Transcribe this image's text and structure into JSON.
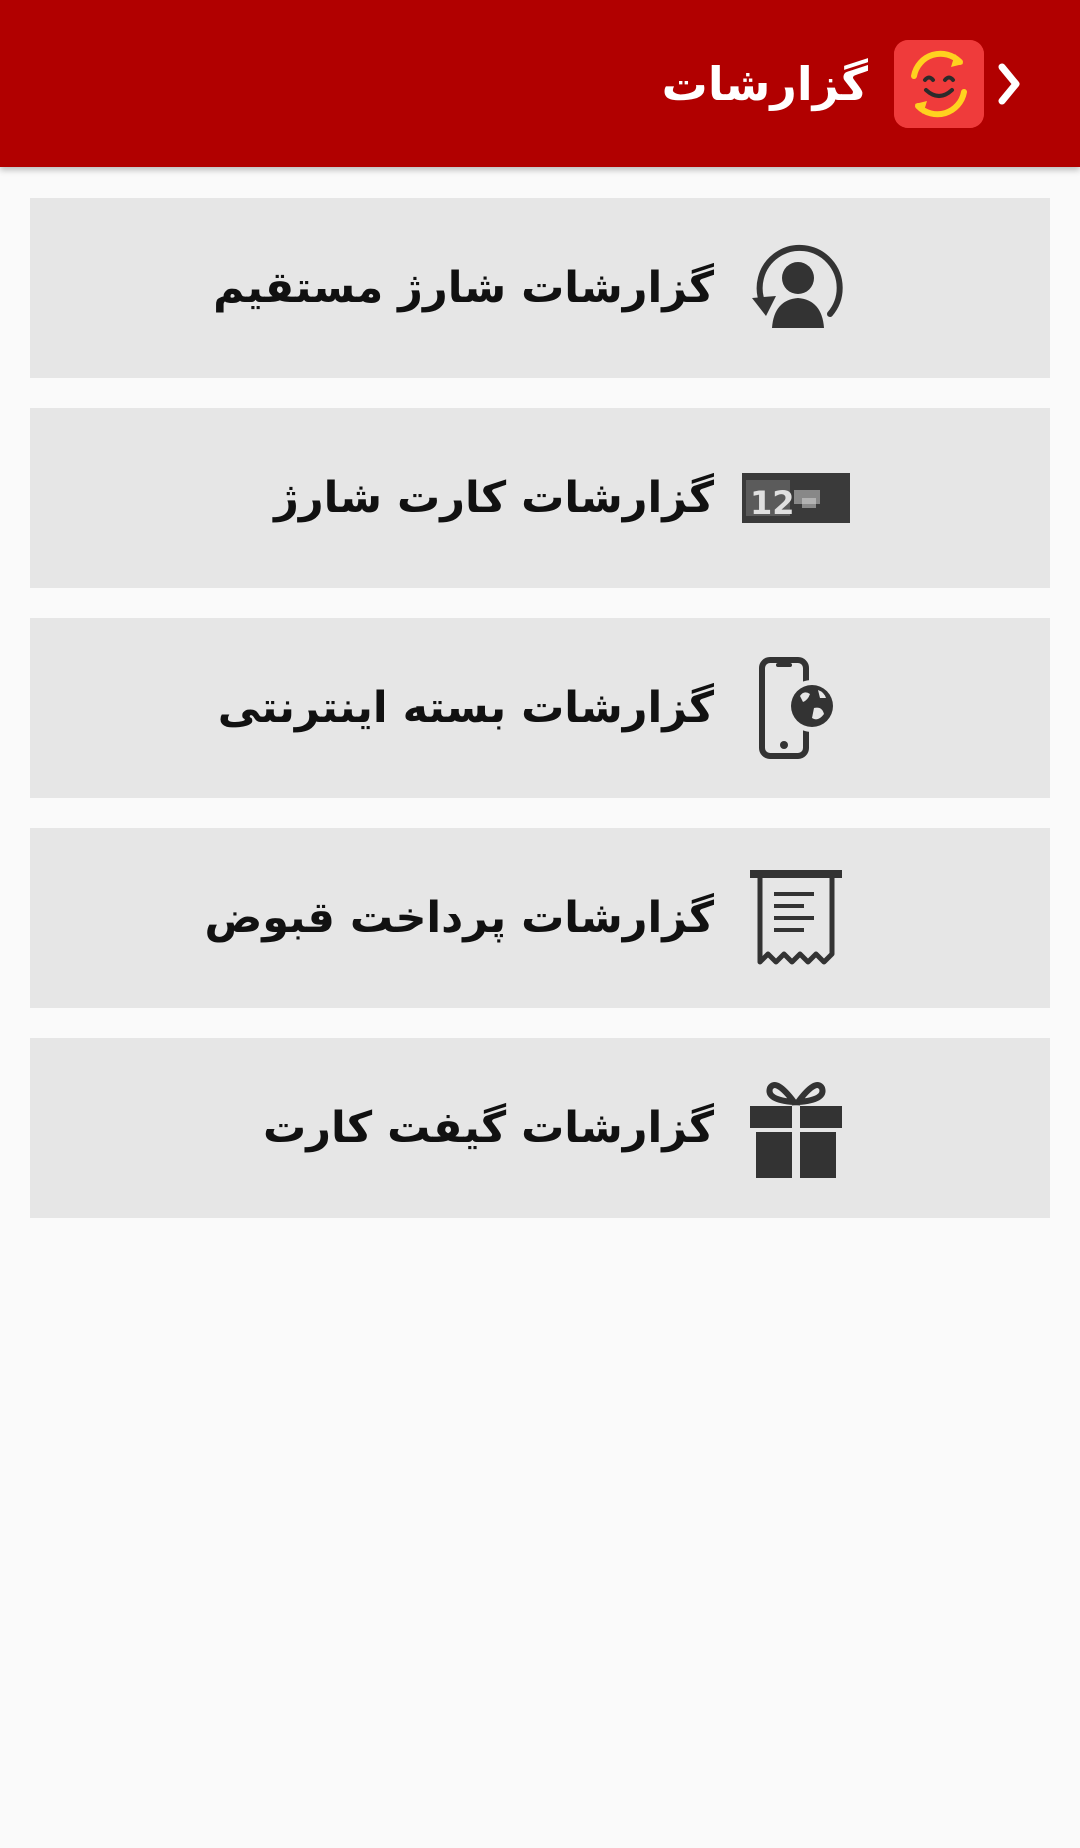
{
  "appbar": {
    "title": "گزارشات",
    "back_icon": "chevron-right-icon",
    "logo_icon": "smile-sync-logo",
    "background_color": "#b10000"
  },
  "menu": {
    "items": [
      {
        "label": "گزارشات شارژ مستقیم",
        "icon": "user-refresh-icon"
      },
      {
        "label": "گزارشات کارت شارژ",
        "icon": "charge-card-icon"
      },
      {
        "label": "گزارشات بسته اینترنتی",
        "icon": "mobile-globe-icon"
      },
      {
        "label": "گزارشات پرداخت قبوض",
        "icon": "receipt-icon"
      },
      {
        "label": "گزارشات گیفت کارت",
        "icon": "gift-icon"
      }
    ]
  }
}
